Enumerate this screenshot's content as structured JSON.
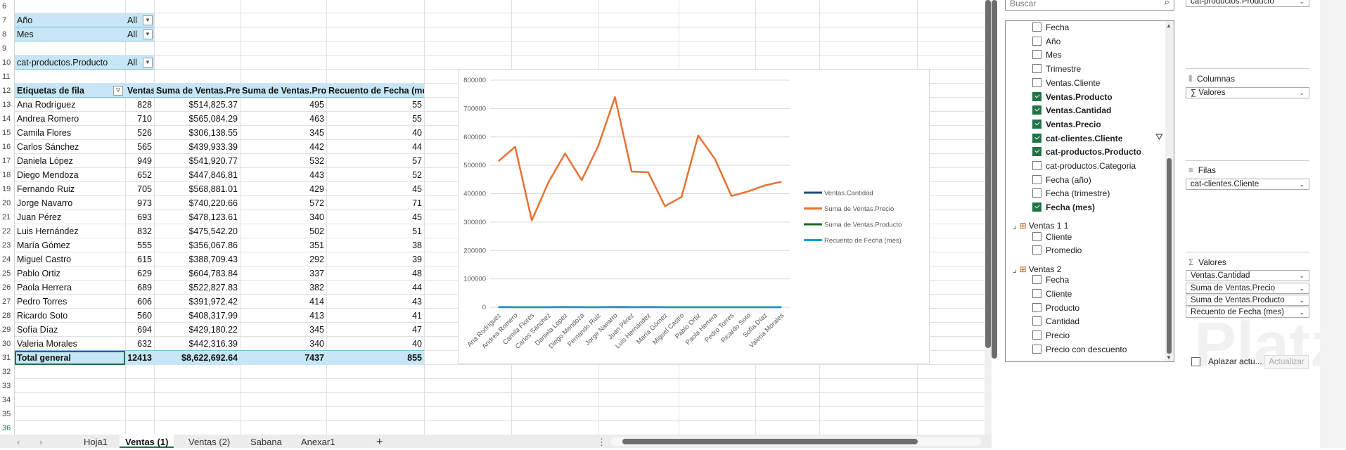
{
  "filters": [
    {
      "label": "Año",
      "value": "All"
    },
    {
      "label": "Mes",
      "value": "All"
    },
    {
      "label": "cat-productos.Producto",
      "value": "All"
    }
  ],
  "pivot": {
    "headers": [
      "Etiquetas de fila",
      "Ventas.Cantidad",
      "Suma de Ventas.Precio",
      "Suma de Ventas.Producto",
      "Recuento de Fecha (mes)"
    ],
    "rows": [
      [
        "Ana Rodríguez",
        "828",
        "$514,825.37",
        "495",
        "55"
      ],
      [
        "Andrea Romero",
        "710",
        "$565,084.29",
        "463",
        "55"
      ],
      [
        "Camila Flores",
        "526",
        "$306,138.55",
        "345",
        "40"
      ],
      [
        "Carlos Sánchez",
        "565",
        "$439,933.39",
        "442",
        "44"
      ],
      [
        "Daniela López",
        "949",
        "$541,920.77",
        "532",
        "57"
      ],
      [
        "Diego Mendoza",
        "652",
        "$447,846.81",
        "443",
        "52"
      ],
      [
        "Fernando Ruiz",
        "705",
        "$568,881.01",
        "429",
        "45"
      ],
      [
        "Jorge Navarro",
        "973",
        "$740,220.66",
        "572",
        "71"
      ],
      [
        "Juan Pérez",
        "693",
        "$478,123.61",
        "340",
        "45"
      ],
      [
        "Luis Hernández",
        "832",
        "$475,542.20",
        "502",
        "51"
      ],
      [
        "María Gómez",
        "555",
        "$356,067.86",
        "351",
        "38"
      ],
      [
        "Miguel Castro",
        "615",
        "$388,709.43",
        "292",
        "39"
      ],
      [
        "Pablo Ortiz",
        "629",
        "$604,783.84",
        "337",
        "48"
      ],
      [
        "Paola Herrera",
        "689",
        "$522,827.83",
        "382",
        "44"
      ],
      [
        "Pedro Torres",
        "606",
        "$391,972.42",
        "414",
        "43"
      ],
      [
        "Ricardo Soto",
        "560",
        "$408,317.99",
        "413",
        "41"
      ],
      [
        "Sofía Díaz",
        "694",
        "$429,180.22",
        "345",
        "47"
      ],
      [
        "Valeria Morales",
        "632",
        "$442,316.39",
        "340",
        "40"
      ]
    ],
    "total": [
      "Total general",
      "12413",
      "$8,622,692.64",
      "7437",
      "855"
    ]
  },
  "chart_data": {
    "type": "line",
    "categories": [
      "Ana Rodríguez",
      "Andrea Romero",
      "Camila Flores",
      "Carlos Sánchez",
      "Daniela López",
      "Diego Mendoza",
      "Fernando Ruiz",
      "Jorge Navarro",
      "Juan Pérez",
      "Luis Hernández",
      "María Gómez",
      "Miguel Castro",
      "Pablo Ortiz",
      "Paola Herrera",
      "Pedro Torres",
      "Ricardo Soto",
      "Sofía Díaz",
      "Valeria Morales"
    ],
    "series": [
      {
        "name": "Ventas.Cantidad",
        "color": "#1f4e79",
        "values": [
          828,
          710,
          526,
          565,
          949,
          652,
          705,
          973,
          693,
          832,
          555,
          615,
          629,
          689,
          606,
          560,
          694,
          632
        ]
      },
      {
        "name": "Suma de Ventas.Precio",
        "color": "#e97132",
        "values": [
          514825.37,
          565084.29,
          306138.55,
          439933.39,
          541920.77,
          447846.81,
          568881.01,
          740220.66,
          478123.61,
          475542.2,
          356067.86,
          388709.43,
          604783.84,
          522827.83,
          391972.42,
          408317.99,
          429180.22,
          442316.39
        ]
      },
      {
        "name": "Suma de Ventas.Producto",
        "color": "#196b24",
        "values": [
          495,
          463,
          345,
          442,
          532,
          443,
          429,
          572,
          340,
          502,
          351,
          292,
          337,
          382,
          414,
          413,
          345,
          340
        ]
      },
      {
        "name": "Recuento de Fecha (mes)",
        "color": "#0f9ed5",
        "values": [
          55,
          55,
          40,
          44,
          57,
          52,
          45,
          71,
          45,
          51,
          38,
          39,
          48,
          44,
          43,
          41,
          47,
          40
        ]
      }
    ],
    "ylim": [
      0,
      800000
    ],
    "yticks": [
      "0",
      "100000",
      "200000",
      "300000",
      "400000",
      "500000",
      "600000",
      "700000",
      "800000"
    ],
    "legend": "right",
    "grid": true
  },
  "tabs": [
    "Hoja1",
    "Ventas (1)",
    "Ventas (2)",
    "Sabana",
    "Anexar1"
  ],
  "tab_add": "+",
  "panel": {
    "search_placeholder": "Buscar",
    "fields": [
      {
        "label": "Fecha",
        "checked": false
      },
      {
        "label": "Año",
        "checked": false
      },
      {
        "label": "Mes",
        "checked": false
      },
      {
        "label": "Trimestre",
        "checked": false
      },
      {
        "label": "Ventas.Cliente",
        "checked": false
      },
      {
        "label": "Ventas.Producto",
        "checked": true
      },
      {
        "label": "Ventas.Cantidad",
        "checked": true
      },
      {
        "label": "Ventas.Precio",
        "checked": true
      },
      {
        "label": "cat-clientes.Cliente",
        "checked": true
      },
      {
        "label": "cat-productos.Producto",
        "checked": true
      },
      {
        "label": "cat-productos.Categoria",
        "checked": false
      },
      {
        "label": "Fecha (año)",
        "checked": false
      },
      {
        "label": "Fecha (trimestre)",
        "checked": false
      },
      {
        "label": "Fecha (mes)",
        "checked": true
      }
    ],
    "groups": [
      {
        "name": "Ventas  1 1",
        "fields": [
          "Cliente",
          "Promedio"
        ]
      },
      {
        "name": "Ventas  2",
        "fields": [
          "Fecha",
          "Cliente",
          "Producto",
          "Cantidad",
          "Precio",
          "Precio con descuento"
        ]
      }
    ],
    "filter_area_item": "cat-productos.Producto",
    "columns_label": "Columnas",
    "columns_item": "Valores",
    "rows_label": "Filas",
    "rows_item": "cat-clientes.Cliente",
    "values_label": "Valores",
    "values_items": [
      "Ventas.Cantidad",
      "Suma de Ventas.Precio",
      "Suma de Ventas.Producto",
      "Recuento de Fecha (mes)"
    ],
    "defer_label": "Aplazar actu...",
    "update_label": "Actualizar",
    "watermark": "Platzi"
  }
}
